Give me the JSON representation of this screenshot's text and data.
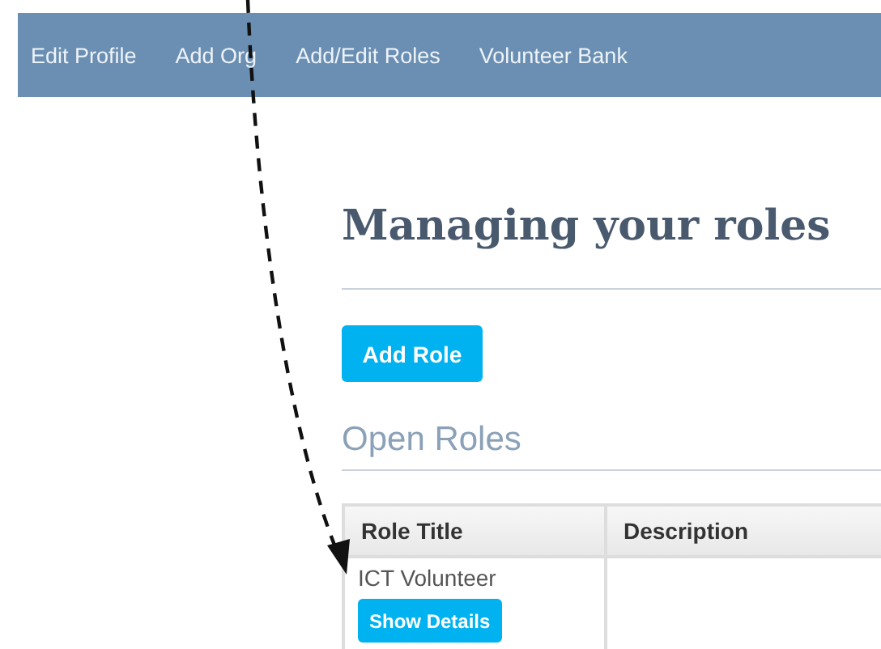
{
  "nav": {
    "items": [
      {
        "label": "Edit Profile"
      },
      {
        "label": "Add Org"
      },
      {
        "label": "Add/Edit Roles"
      },
      {
        "label": "Volunteer Bank"
      }
    ]
  },
  "page_title": "Managing your roles",
  "add_button": "Add Role",
  "section_title": "Open Roles",
  "table": {
    "columns": [
      "Role Title",
      "Description"
    ],
    "rows": [
      {
        "title": "ICT Volunteer",
        "button": "Show Details"
      }
    ]
  }
}
